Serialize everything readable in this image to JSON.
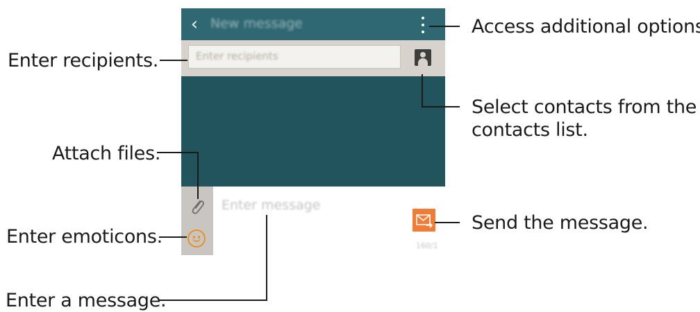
{
  "screen": {
    "app_bar": {
      "title": "New message",
      "back_icon": "chevron-left-icon",
      "menu_icon": "more-vertical-icon"
    },
    "recipients": {
      "placeholder": "Enter recipients",
      "contact_icon": "contact-person-icon"
    },
    "composer": {
      "placeholder": "Enter message",
      "attach_icon": "paperclip-icon",
      "emoticon_icon": "smiley-icon",
      "send_icon": "envelope-send-icon",
      "char_count": "160/1"
    },
    "colors": {
      "app_bar": "#2f6772",
      "background": "#22545d",
      "recipient_bar": "#d7d3cc",
      "accent": "#ef7d38"
    }
  },
  "callouts": {
    "more_options": "Access additional options.",
    "recipients": "Enter recipients.",
    "contacts_line1": "Select contacts from the",
    "contacts_line2": "contacts list.",
    "attach": "Attach files.",
    "send": "Send the message.",
    "emoticons": "Enter emoticons.",
    "message": "Enter a message."
  }
}
